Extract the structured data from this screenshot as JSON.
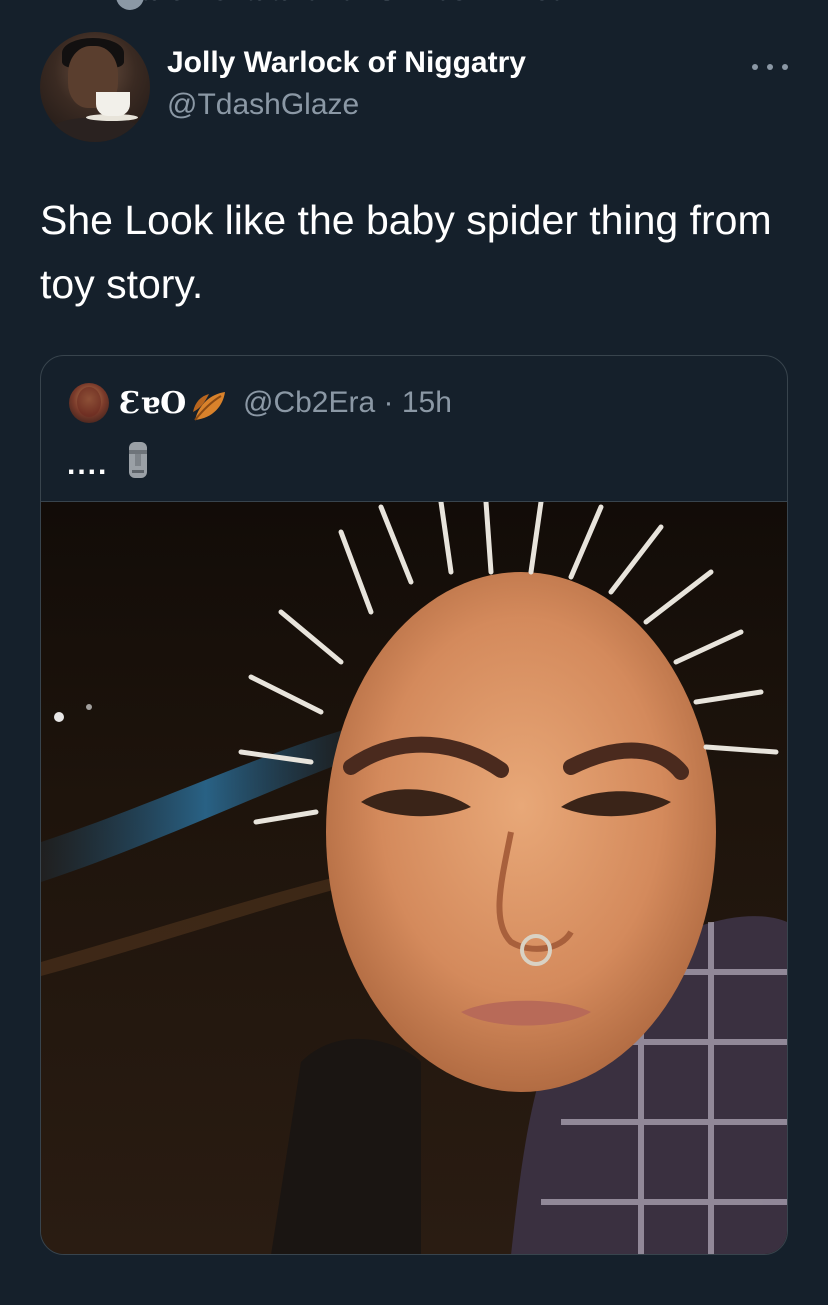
{
  "liked_bar": {
    "text": "Claremelia and Idris Elbow liked"
  },
  "tweet": {
    "display_name": "Jolly Warlock of Niggatry",
    "handle": "@TdashGlaze",
    "text": "She Look like the baby spider thing from toy story."
  },
  "quoted_tweet": {
    "display_name": "ƐɐO",
    "handle_time": "@Cb2Era · 15h",
    "text": "....",
    "emoji_names": [
      "leaf-emoji",
      "moai-emoji"
    ]
  },
  "icons": {
    "more": "more-horizontal-icon"
  },
  "colors": {
    "background": "#15202b",
    "secondary_text": "#8b98a5",
    "border": "#38444d"
  }
}
